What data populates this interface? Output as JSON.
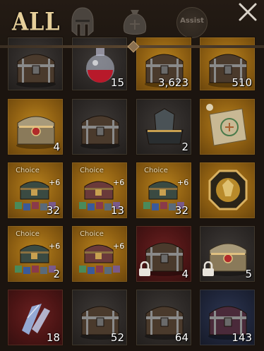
{
  "tabs": {
    "all_label": "ALL",
    "assist_label": "Assist",
    "helmet_icon": "helmet-icon",
    "bag_icon": "bag-icon"
  },
  "colors": {
    "gold_bg": "#9a6a14",
    "gray_bg": "#2e2a27",
    "red_bg": "#4e1616",
    "navy_bg": "#202840",
    "accent": "#e6cf9a"
  },
  "items": [
    {
      "icon": "chest-icon",
      "bg": "gray",
      "qty": "",
      "choice": "",
      "plus": "",
      "locked": false
    },
    {
      "icon": "potion-icon",
      "bg": "gray",
      "qty": "15",
      "choice": "",
      "plus": "",
      "locked": false
    },
    {
      "icon": "chest-icon",
      "bg": "gold",
      "qty": "3,623",
      "choice": "",
      "plus": "",
      "locked": false
    },
    {
      "icon": "chest-icon",
      "bg": "gold",
      "qty": "510",
      "choice": "",
      "plus": "",
      "locked": false
    },
    {
      "icon": "ornate-chest-icon",
      "bg": "gold",
      "qty": "4",
      "choice": "",
      "plus": "",
      "locked": false
    },
    {
      "icon": "chest-icon",
      "bg": "gray",
      "qty": "",
      "choice": "",
      "plus": "",
      "locked": false
    },
    {
      "icon": "armor-chest-icon",
      "bg": "gray",
      "qty": "2",
      "choice": "",
      "plus": "",
      "locked": false
    },
    {
      "icon": "scroll-icon",
      "bg": "gold",
      "qty": "",
      "choice": "",
      "plus": "",
      "locked": false
    },
    {
      "icon": "choice-chest-icon",
      "bg": "gold",
      "qty": "32",
      "choice": "Choice",
      "plus": "+6",
      "locked": false
    },
    {
      "icon": "choice-chest-icon",
      "bg": "gold",
      "qty": "13",
      "choice": "Choice",
      "plus": "+6",
      "locked": false
    },
    {
      "icon": "choice-chest-icon",
      "bg": "gold",
      "qty": "32",
      "choice": "Choice",
      "plus": "+6",
      "locked": false
    },
    {
      "icon": "emblem-icon",
      "bg": "gold",
      "qty": "",
      "choice": "",
      "plus": "",
      "locked": false
    },
    {
      "icon": "choice-chest-icon",
      "bg": "gold",
      "qty": "2",
      "choice": "Choice",
      "plus": "+6",
      "locked": false
    },
    {
      "icon": "choice-chest-icon",
      "bg": "gold",
      "qty": "",
      "choice": "Choice",
      "plus": "+6",
      "locked": false
    },
    {
      "icon": "chest-icon",
      "bg": "red",
      "qty": "4",
      "choice": "",
      "plus": "",
      "locked": true
    },
    {
      "icon": "ornate-chest-icon",
      "bg": "gray",
      "qty": "5",
      "choice": "",
      "plus": "",
      "locked": true
    },
    {
      "icon": "crystal-icon",
      "bg": "red",
      "qty": "18",
      "choice": "",
      "plus": "",
      "locked": false
    },
    {
      "icon": "chest-icon",
      "bg": "gray",
      "qty": "52",
      "choice": "",
      "plus": "",
      "locked": false
    },
    {
      "icon": "chest-icon",
      "bg": "gray",
      "qty": "64",
      "choice": "",
      "plus": "",
      "locked": false
    },
    {
      "icon": "chest-icon",
      "bg": "navy",
      "qty": "143",
      "choice": "",
      "plus": "",
      "locked": false
    }
  ]
}
